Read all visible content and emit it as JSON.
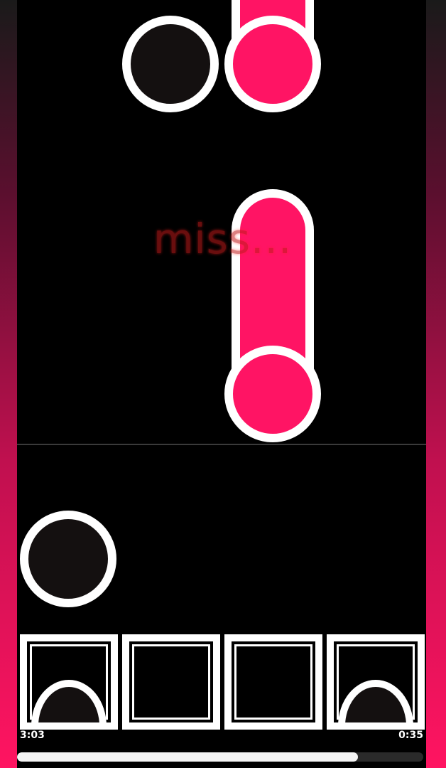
{
  "judgement": "miss...",
  "time": {
    "elapsed": "3:03",
    "remaining": "0:35"
  },
  "progress": 0.84,
  "colors": {
    "note_pink": "#ff1464",
    "note_dark": "#141010",
    "outline": "#ffffff",
    "side_gradient_end": "#ff1461"
  },
  "lanes": [
    "lane-1",
    "lane-2",
    "lane-3",
    "lane-4"
  ]
}
